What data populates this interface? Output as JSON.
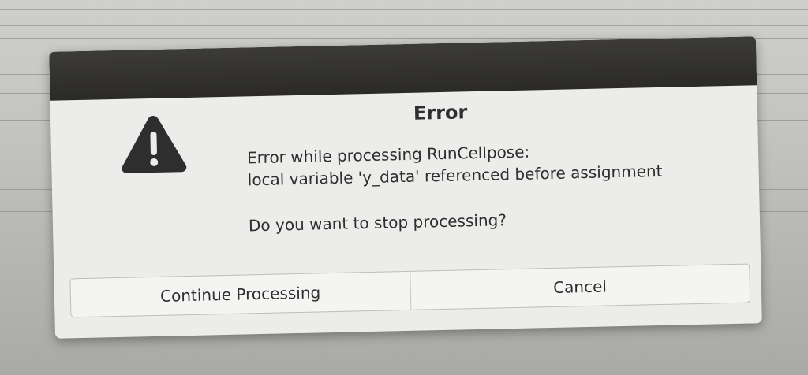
{
  "dialog": {
    "title": "Error",
    "icon": "warning-icon",
    "message_lines": [
      "Error while processing RunCellpose:",
      "local variable 'y_data' referenced before assignment"
    ],
    "question": "Do you want to stop processing?",
    "buttons": {
      "continue_label": "Continue Processing",
      "cancel_label": "Cancel"
    }
  },
  "colors": {
    "titlebar": "#2b2a28",
    "dialog_background": "#ececea",
    "text": "#2e2e2e",
    "icon": "#2e2e2e"
  }
}
